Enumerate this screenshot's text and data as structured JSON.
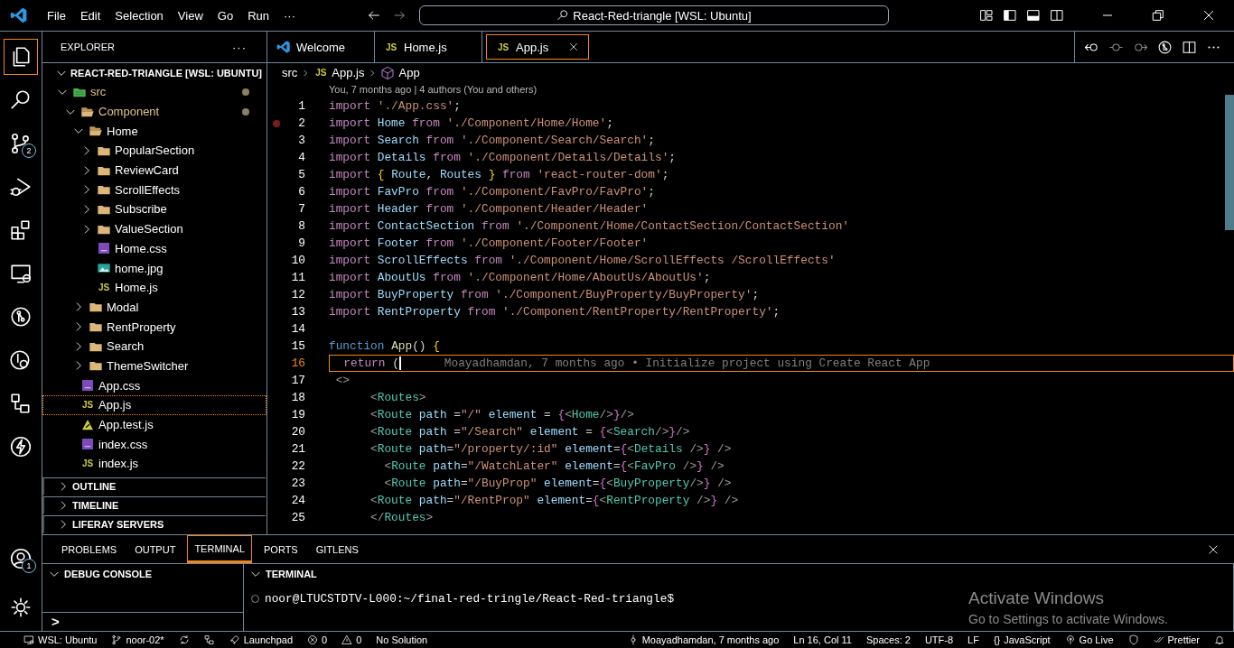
{
  "title_bar": {
    "menu": [
      "File",
      "Edit",
      "Selection",
      "View",
      "Go",
      "Run",
      "···"
    ],
    "command_center": "React-Red-triangle [WSL: Ubuntu]"
  },
  "activity_bar": {
    "items": [
      {
        "kind": "files",
        "selected": true
      },
      {
        "kind": "search",
        "selected": false
      },
      {
        "kind": "branch",
        "selected": false,
        "badge": "2"
      },
      {
        "kind": "debug",
        "selected": false
      },
      {
        "kind": "extensions",
        "selected": false
      },
      {
        "kind": "remote",
        "selected": false
      },
      {
        "kind": "gitlens",
        "selected": false
      },
      {
        "kind": "inspect",
        "selected": false
      },
      {
        "kind": "graph",
        "selected": false
      },
      {
        "kind": "bolt",
        "selected": false
      }
    ],
    "bottom_items": [
      {
        "kind": "account",
        "badge": "1"
      },
      {
        "kind": "manage"
      }
    ]
  },
  "sidebar": {
    "title": "EXPLORER",
    "more": "···",
    "root": {
      "label": "REACT-RED-TRIANGLE [WSL: UBUNTU]",
      "expanded": true,
      "children": [
        {
          "label": "src",
          "kind": "special-folder",
          "expanded": true,
          "modified": true,
          "selected": false,
          "children": [
            {
              "label": "Component",
              "kind": "folder",
              "expanded": true,
              "modified": true,
              "selected": false,
              "children": [
                {
                  "label": "Home",
                  "kind": "folder",
                  "expanded": true,
                  "modified": false,
                  "selected": false,
                  "children": [
                    {
                      "label": "PopularSection",
                      "kind": "folder",
                      "expanded": false,
                      "modified": false,
                      "selected": false
                    },
                    {
                      "label": "ReviewCard",
                      "kind": "folder",
                      "expanded": false,
                      "modified": false,
                      "selected": false
                    },
                    {
                      "label": "ScrollEffects",
                      "kind": "folder",
                      "expanded": false,
                      "modified": false,
                      "selected": false
                    },
                    {
                      "label": "Subscribe",
                      "kind": "folder",
                      "expanded": false,
                      "modified": false,
                      "selected": false
                    },
                    {
                      "label": "ValueSection",
                      "kind": "folder",
                      "expanded": false,
                      "modified": false,
                      "selected": false
                    },
                    {
                      "label": "Home.css",
                      "kind": "css",
                      "modified": false,
                      "selected": false
                    },
                    {
                      "label": "home.jpg",
                      "kind": "image",
                      "modified": false,
                      "selected": false
                    },
                    {
                      "label": "Home.js",
                      "kind": "js",
                      "icon_label": "JS",
                      "modified": false,
                      "selected": false
                    }
                  ]
                },
                {
                  "label": "Modal",
                  "kind": "folder",
                  "expanded": false,
                  "modified": false,
                  "selected": false
                },
                {
                  "label": "RentProperty",
                  "kind": "folder",
                  "expanded": false,
                  "modified": false,
                  "selected": false
                },
                {
                  "label": "Search",
                  "kind": "folder",
                  "expanded": false,
                  "modified": false,
                  "selected": false
                },
                {
                  "label": "ThemeSwitcher",
                  "kind": "folder",
                  "expanded": false,
                  "modified": false,
                  "selected": false
                }
              ]
            },
            {
              "label": "App.css",
              "kind": "css",
              "modified": false,
              "selected": false
            },
            {
              "label": "App.js",
              "kind": "js",
              "icon_label": "JS",
              "modified": false,
              "selected": true
            },
            {
              "label": "App.test.js",
              "kind": "test",
              "modified": false,
              "selected": false
            },
            {
              "label": "index.css",
              "kind": "css",
              "modified": false,
              "selected": false
            },
            {
              "label": "index.js",
              "kind": "js",
              "icon_label": "JS",
              "modified": false,
              "selected": false
            }
          ]
        }
      ]
    },
    "sections": [
      {
        "label": "OUTLINE",
        "expanded": false
      },
      {
        "label": "TIMELINE",
        "expanded": false
      },
      {
        "label": "LIFERAY SERVERS",
        "expanded": false
      }
    ]
  },
  "editor": {
    "tabs": [
      {
        "label": "Welcome",
        "kind": "welcome",
        "selected": false
      },
      {
        "label": "Home.js",
        "kind": "js",
        "icon_label": "JS",
        "selected": false
      },
      {
        "label": "App.js",
        "kind": "js",
        "icon_label": "JS",
        "selected": true
      }
    ],
    "breadcrumb": [
      {
        "label": "src",
        "kind": "folder"
      },
      {
        "label": "App.js",
        "kind": "js",
        "icon_label": "JS"
      },
      {
        "label": "App",
        "kind": "symbol"
      }
    ],
    "codelens": "You, 7 months ago | 4 authors (You and others)",
    "lines": [
      {
        "n": "1",
        "current": false,
        "tokens": [
          {
            "kind": "kw",
            "text": "import "
          },
          {
            "kind": "s",
            "text": "'./App.css'"
          },
          {
            "kind": "p",
            "text": ";"
          }
        ]
      },
      {
        "n": "2",
        "current": false,
        "breakpoint": true,
        "tokens": [
          {
            "kind": "kw",
            "text": "import "
          },
          {
            "kind": "id",
            "text": "Home "
          },
          {
            "kind": "kw",
            "text": "from "
          },
          {
            "kind": "s",
            "text": "'./Component/Home/Home'"
          },
          {
            "kind": "p",
            "text": ";"
          }
        ]
      },
      {
        "n": "3",
        "current": false,
        "tokens": [
          {
            "kind": "kw",
            "text": "import "
          },
          {
            "kind": "id",
            "text": "Search "
          },
          {
            "kind": "kw",
            "text": "from "
          },
          {
            "kind": "s",
            "text": "'./Component/Search/Search'"
          },
          {
            "kind": "p",
            "text": ";"
          }
        ]
      },
      {
        "n": "4",
        "current": false,
        "tokens": [
          {
            "kind": "kw",
            "text": "import "
          },
          {
            "kind": "id",
            "text": "Details "
          },
          {
            "kind": "kw",
            "text": "from "
          },
          {
            "kind": "s",
            "text": "'./Component/Details/Details'"
          },
          {
            "kind": "p",
            "text": ";"
          }
        ]
      },
      {
        "n": "5",
        "current": false,
        "tokens": [
          {
            "kind": "kw",
            "text": "import "
          },
          {
            "kind": "br",
            "text": "{ "
          },
          {
            "kind": "id",
            "text": "Route"
          },
          {
            "kind": "p",
            "text": ", "
          },
          {
            "kind": "id",
            "text": "Routes "
          },
          {
            "kind": "br",
            "text": "} "
          },
          {
            "kind": "kw",
            "text": "from "
          },
          {
            "kind": "s",
            "text": "'react-router-dom'"
          },
          {
            "kind": "p",
            "text": ";"
          }
        ]
      },
      {
        "n": "6",
        "current": false,
        "tokens": [
          {
            "kind": "kw",
            "text": "import "
          },
          {
            "kind": "id",
            "text": "FavPro "
          },
          {
            "kind": "kw",
            "text": "from "
          },
          {
            "kind": "s",
            "text": "'./Component/FavPro/FavPro'"
          },
          {
            "kind": "p",
            "text": ";"
          }
        ]
      },
      {
        "n": "7",
        "current": false,
        "tokens": [
          {
            "kind": "kw",
            "text": "import "
          },
          {
            "kind": "id",
            "text": "Header "
          },
          {
            "kind": "kw",
            "text": "from "
          },
          {
            "kind": "s",
            "text": "'./Component/Header/Header'"
          }
        ]
      },
      {
        "n": "8",
        "current": false,
        "tokens": [
          {
            "kind": "kw",
            "text": "import "
          },
          {
            "kind": "id",
            "text": "ContactSection "
          },
          {
            "kind": "kw",
            "text": "from "
          },
          {
            "kind": "s",
            "text": "'./Component/Home/ContactSection/ContactSection'"
          }
        ]
      },
      {
        "n": "9",
        "current": false,
        "tokens": [
          {
            "kind": "kw",
            "text": "import "
          },
          {
            "kind": "id",
            "text": "Footer "
          },
          {
            "kind": "kw",
            "text": "from "
          },
          {
            "kind": "s",
            "text": "'./Component/Footer/Footer'"
          }
        ]
      },
      {
        "n": "10",
        "current": false,
        "tokens": [
          {
            "kind": "kw",
            "text": "import "
          },
          {
            "kind": "id",
            "text": "ScrollEffects "
          },
          {
            "kind": "kw",
            "text": "from "
          },
          {
            "kind": "s",
            "text": "'./Component/Home/ScrollEffects /ScrollEffects'"
          }
        ]
      },
      {
        "n": "11",
        "current": false,
        "tokens": [
          {
            "kind": "kw",
            "text": "import "
          },
          {
            "kind": "id",
            "text": "AboutUs "
          },
          {
            "kind": "kw",
            "text": "from "
          },
          {
            "kind": "s",
            "text": "'./Component/Home/AboutUs/AboutUs'"
          },
          {
            "kind": "p",
            "text": ";"
          }
        ]
      },
      {
        "n": "12",
        "current": false,
        "tokens": [
          {
            "kind": "kw",
            "text": "import "
          },
          {
            "kind": "id",
            "text": "BuyProperty "
          },
          {
            "kind": "kw",
            "text": "from "
          },
          {
            "kind": "s",
            "text": "'./Component/BuyProperty/BuyProperty'"
          },
          {
            "kind": "p",
            "text": ";"
          }
        ]
      },
      {
        "n": "13",
        "current": false,
        "tokens": [
          {
            "kind": "kw",
            "text": "import "
          },
          {
            "kind": "id",
            "text": "RentProperty "
          },
          {
            "kind": "kw",
            "text": "from "
          },
          {
            "kind": "s",
            "text": "'./Component/RentProperty/RentProperty'"
          },
          {
            "kind": "p",
            "text": ";"
          }
        ]
      },
      {
        "n": "14",
        "current": false
      },
      {
        "n": "15",
        "current": false,
        "tokens": [
          {
            "kind": "decl",
            "text": "function "
          },
          {
            "kind": "fn",
            "text": "App"
          },
          {
            "kind": "p",
            "text": "() "
          },
          {
            "kind": "br",
            "text": "{"
          }
        ]
      },
      {
        "n": "16",
        "current": true,
        "blame": "Moayadhamdan, 7 months ago • Initialize project using Create React App",
        "tokens": [
          {
            "kind": "kw",
            "text": "  return "
          },
          {
            "kind": "p",
            "text": "("
          }
        ]
      },
      {
        "n": "17",
        "current": false,
        "tokens": [
          {
            "kind": "lt",
            "text": " <>"
          }
        ]
      },
      {
        "n": "18",
        "current": false,
        "tokens": [
          {
            "kind": "lt",
            "text": "      <"
          },
          {
            "kind": "tag",
            "text": "Routes"
          },
          {
            "kind": "lt",
            "text": ">"
          }
        ]
      },
      {
        "n": "19",
        "current": false,
        "tokens": [
          {
            "kind": "lt",
            "text": "      <"
          },
          {
            "kind": "tag",
            "text": "Route "
          },
          {
            "kind": "id",
            "text": "path "
          },
          {
            "kind": "p",
            "text": "="
          },
          {
            "kind": "s",
            "text": "\"/\" "
          },
          {
            "kind": "id",
            "text": "element "
          },
          {
            "kind": "p",
            "text": "= "
          },
          {
            "kind": "br2",
            "text": "{"
          },
          {
            "kind": "lt",
            "text": "<"
          },
          {
            "kind": "tag",
            "text": "Home"
          },
          {
            "kind": "lt",
            "text": "/>"
          },
          {
            "kind": "br2",
            "text": "}"
          },
          {
            "kind": "lt",
            "text": "/>"
          }
        ]
      },
      {
        "n": "20",
        "current": false,
        "tokens": [
          {
            "kind": "lt",
            "text": "      <"
          },
          {
            "kind": "tag",
            "text": "Route "
          },
          {
            "kind": "id",
            "text": "path "
          },
          {
            "kind": "p",
            "text": "="
          },
          {
            "kind": "s",
            "text": "\"/Search\" "
          },
          {
            "kind": "id",
            "text": "element "
          },
          {
            "kind": "p",
            "text": "= "
          },
          {
            "kind": "br2",
            "text": "{"
          },
          {
            "kind": "lt",
            "text": "<"
          },
          {
            "kind": "tag",
            "text": "Search"
          },
          {
            "kind": "lt",
            "text": "/>"
          },
          {
            "kind": "br2",
            "text": "}"
          },
          {
            "kind": "lt",
            "text": "/>"
          }
        ]
      },
      {
        "n": "21",
        "current": false,
        "tokens": [
          {
            "kind": "lt",
            "text": "      <"
          },
          {
            "kind": "tag",
            "text": "Route "
          },
          {
            "kind": "id",
            "text": "path"
          },
          {
            "kind": "p",
            "text": "="
          },
          {
            "kind": "s",
            "text": "\"/property/:id\" "
          },
          {
            "kind": "id",
            "text": "element"
          },
          {
            "kind": "p",
            "text": "="
          },
          {
            "kind": "br2",
            "text": "{"
          },
          {
            "kind": "lt",
            "text": "<"
          },
          {
            "kind": "tag",
            "text": "Details "
          },
          {
            "kind": "lt",
            "text": "/>"
          },
          {
            "kind": "br2",
            "text": "} "
          },
          {
            "kind": "lt",
            "text": "/>"
          }
        ]
      },
      {
        "n": "22",
        "current": false,
        "tokens": [
          {
            "kind": "lt",
            "text": "        <"
          },
          {
            "kind": "tag",
            "text": "Route "
          },
          {
            "kind": "id",
            "text": "path"
          },
          {
            "kind": "p",
            "text": "="
          },
          {
            "kind": "s",
            "text": "\"/WatchLater\" "
          },
          {
            "kind": "id",
            "text": "element"
          },
          {
            "kind": "p",
            "text": "="
          },
          {
            "kind": "br2",
            "text": "{"
          },
          {
            "kind": "lt",
            "text": "<"
          },
          {
            "kind": "tag",
            "text": "FavPro "
          },
          {
            "kind": "lt",
            "text": "/>"
          },
          {
            "kind": "br2",
            "text": "} "
          },
          {
            "kind": "lt",
            "text": "/>"
          }
        ]
      },
      {
        "n": "23",
        "current": false,
        "tokens": [
          {
            "kind": "lt",
            "text": "        <"
          },
          {
            "kind": "tag",
            "text": "Route "
          },
          {
            "kind": "id",
            "text": "path"
          },
          {
            "kind": "p",
            "text": "="
          },
          {
            "kind": "s",
            "text": "\"/BuyProp\" "
          },
          {
            "kind": "id",
            "text": "element"
          },
          {
            "kind": "p",
            "text": "="
          },
          {
            "kind": "br2",
            "text": "{"
          },
          {
            "kind": "lt",
            "text": "<"
          },
          {
            "kind": "tag",
            "text": "BuyProperty"
          },
          {
            "kind": "lt",
            "text": "/>"
          },
          {
            "kind": "br2",
            "text": "} "
          },
          {
            "kind": "lt",
            "text": "/>"
          }
        ]
      },
      {
        "n": "24",
        "current": false,
        "tokens": [
          {
            "kind": "lt",
            "text": "      <"
          },
          {
            "kind": "tag",
            "text": "Route "
          },
          {
            "kind": "id",
            "text": "path"
          },
          {
            "kind": "p",
            "text": "="
          },
          {
            "kind": "s",
            "text": "\"/RentProp\" "
          },
          {
            "kind": "id",
            "text": "element"
          },
          {
            "kind": "p",
            "text": "="
          },
          {
            "kind": "br2",
            "text": "{"
          },
          {
            "kind": "lt",
            "text": "<"
          },
          {
            "kind": "tag",
            "text": "RentProperty "
          },
          {
            "kind": "lt",
            "text": "/>"
          },
          {
            "kind": "br2",
            "text": "} "
          },
          {
            "kind": "lt",
            "text": "/>"
          }
        ]
      },
      {
        "n": "25",
        "current": false,
        "tokens": [
          {
            "kind": "lt",
            "text": "      </"
          },
          {
            "kind": "tag",
            "text": "Routes"
          },
          {
            "kind": "lt",
            "text": ">"
          }
        ]
      }
    ]
  },
  "panel": {
    "tabs": [
      {
        "label": "PROBLEMS",
        "selected": false
      },
      {
        "label": "OUTPUT",
        "selected": false
      },
      {
        "label": "TERMINAL",
        "selected": true
      },
      {
        "label": "PORTS",
        "selected": false
      },
      {
        "label": "GITLENS",
        "selected": false
      }
    ],
    "debug_console": {
      "title": "DEBUG CONSOLE",
      "expanded": true,
      "prompt": ">"
    },
    "terminal": {
      "title": "TERMINAL",
      "expanded": true,
      "lines": [
        "noor@LTUCSTDTV-L000:~/final-red-tringle/React-Red-triangle$"
      ]
    }
  },
  "activation_notice": {
    "title": "Activate Windows",
    "text": "Go to Settings to activate Windows."
  },
  "status_bar": {
    "left": [
      {
        "kind": "remote",
        "text": "WSL: Ubuntu"
      },
      {
        "kind": "branch",
        "text": "noor-02*"
      },
      {
        "kind": "sync"
      },
      {
        "kind": "graph"
      },
      {
        "kind": "rocket",
        "text": "Launchpad"
      },
      {
        "kind": "error",
        "text": "0"
      },
      {
        "kind": "warning",
        "text": "0"
      },
      {
        "kind": "plain",
        "text": "No Solution"
      }
    ],
    "right": [
      {
        "kind": "commit",
        "text": "Moayadhamdan, 7 months ago"
      },
      {
        "kind": "plain",
        "text": "Ln 16, Col 11"
      },
      {
        "kind": "plain",
        "text": "Spaces: 2"
      },
      {
        "kind": "plain",
        "text": "UTF-8"
      },
      {
        "kind": "plain",
        "text": "LF"
      },
      {
        "kind": "glyph",
        "glyph": "{}",
        "text": "JavaScript"
      },
      {
        "kind": "broadcast",
        "text": "Go Live"
      },
      {
        "kind": "shield"
      },
      {
        "kind": "checks",
        "text": "Prettier"
      },
      {
        "kind": "bell"
      }
    ]
  }
}
